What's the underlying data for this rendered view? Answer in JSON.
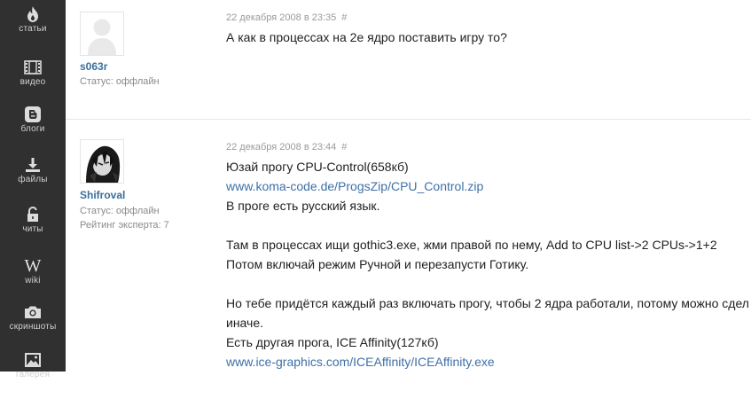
{
  "sidebar": {
    "items": [
      {
        "label": "статьи",
        "icon": "flame-icon"
      },
      {
        "label": "видео",
        "icon": "film-icon"
      },
      {
        "label": "блоги",
        "icon": "blogger-icon"
      },
      {
        "label": "файлы",
        "icon": "download-icon"
      },
      {
        "label": "читы",
        "icon": "unlock-icon"
      },
      {
        "label": "wiki",
        "icon": "wiki-icon"
      },
      {
        "label": "скриншоты",
        "icon": "camera-icon"
      },
      {
        "label": "галерея",
        "icon": "image-icon"
      }
    ]
  },
  "posts": [
    {
      "author": "s063r",
      "status": "Статус: оффлайн",
      "date": "22 декабря 2008 в 23:35",
      "anchor": "#",
      "lines": [
        "А как в процессах на 2е ядро поставить игру то?"
      ]
    },
    {
      "author": "Shifroval",
      "status": "Статус: оффлайн",
      "rating": "Рейтинг эксперта: 7",
      "date": "22 декабря 2008 в 23:44",
      "anchor": "#",
      "lines": [
        "Юзай прогу CPU-Control(658кб)",
        "www.koma-code.de/ProgsZip/CPU_Control.zip",
        "В проге есть русский язык.",
        "Там в процессах ищи gothic3.exe, жми правой по нему, Add to CPU list->2 CPUs->1+2",
        "Потом включай режим Ручной и перезапусти Готику.",
        "Но тебе придётся каждый раз включать прогу, чтобы 2 ядра работали, потому можно сдел",
        "иначе.",
        "Есть другая прога, ICE Affinity(127кб)",
        "www.ice-graphics.com/ICEAffinity/ICEAffinity.exe"
      ]
    }
  ]
}
